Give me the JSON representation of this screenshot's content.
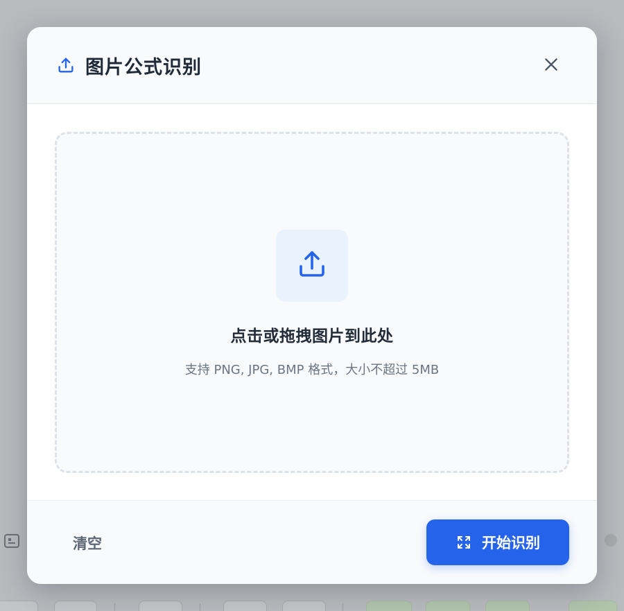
{
  "dialog": {
    "title": "图片公式识别",
    "title_icon": "upload-icon",
    "close_icon": "close-icon"
  },
  "dropzone": {
    "icon": "upload-icon",
    "title": "点击或拖拽图片到此处",
    "hint": "支持 PNG, JPG, BMP 格式，大小不超过 5MB"
  },
  "footer": {
    "clear_label": "清空",
    "start_label": "开始识别",
    "start_icon": "scan-icon"
  },
  "colors": {
    "accent": "#2563eb",
    "overlay": "#b9babe",
    "upload_tile": "#e9f2fd"
  }
}
